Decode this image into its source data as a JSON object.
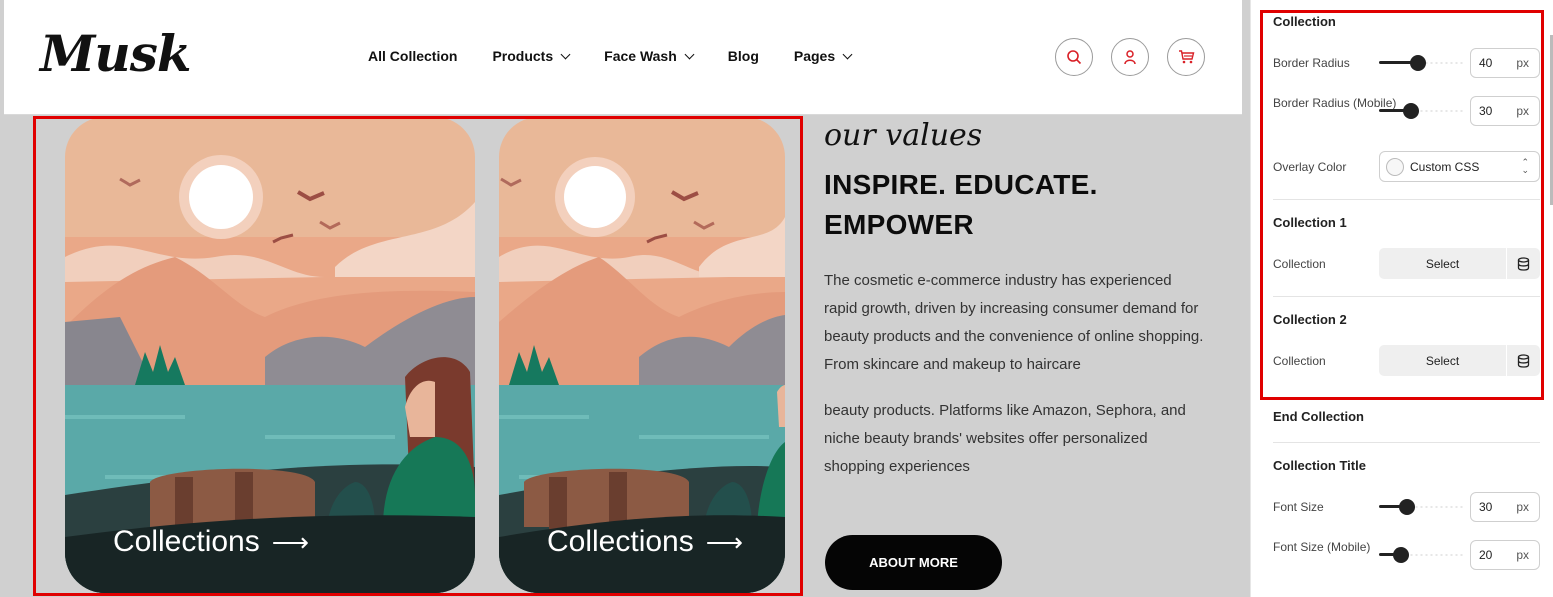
{
  "site": {
    "logo": "Musk",
    "nav": [
      {
        "label": "All Collection",
        "dropdown": false
      },
      {
        "label": "Products",
        "dropdown": true
      },
      {
        "label": "Face Wash",
        "dropdown": true
      },
      {
        "label": "Blog",
        "dropdown": false
      },
      {
        "label": "Pages",
        "dropdown": true
      }
    ],
    "icons": [
      "search-icon",
      "user-icon",
      "cart-icon"
    ],
    "accent_color": "#d92027"
  },
  "collections": [
    {
      "label": "Collections",
      "arrow": "⟶"
    },
    {
      "label": "Collections",
      "arrow": "⟶"
    }
  ],
  "values": {
    "eyebrow": "our values",
    "headline": "INSPIRE. EDUCATE. EMPOWER",
    "paragraph1": "The cosmetic e-commerce industry has experienced rapid growth, driven by increasing consumer demand for beauty products and the convenience of online shopping. From skincare and makeup to haircare",
    "paragraph2": "beauty products. Platforms like Amazon, Sephora, and niche beauty brands' websites offer personalized shopping experiences",
    "button": "ABOUT MORE"
  },
  "panel": {
    "collection_section": "Collection",
    "border_radius": {
      "label": "Border Radius",
      "value": "40",
      "unit": "px",
      "level": 0.45
    },
    "border_radius_mobile": {
      "label": "Border Radius (Mobile)",
      "value": "30",
      "unit": "px",
      "level": 0.35
    },
    "overlay": {
      "label": "Overlay Color",
      "value": "Custom CSS",
      "updown": "⌃⌄"
    },
    "collection1": {
      "title": "Collection 1",
      "label": "Collection",
      "button": "Select"
    },
    "collection2": {
      "title": "Collection 2",
      "label": "Collection",
      "button": "Select"
    },
    "end_collection": "End Collection",
    "collection_title": "Collection Title",
    "font_size": {
      "label": "Font Size",
      "value": "30",
      "unit": "px",
      "level": 0.3
    },
    "font_size_mobile": {
      "label": "Font Size (Mobile)",
      "value": "20",
      "unit": "px",
      "level": 0.2
    }
  },
  "highlight_color": "#e00000"
}
